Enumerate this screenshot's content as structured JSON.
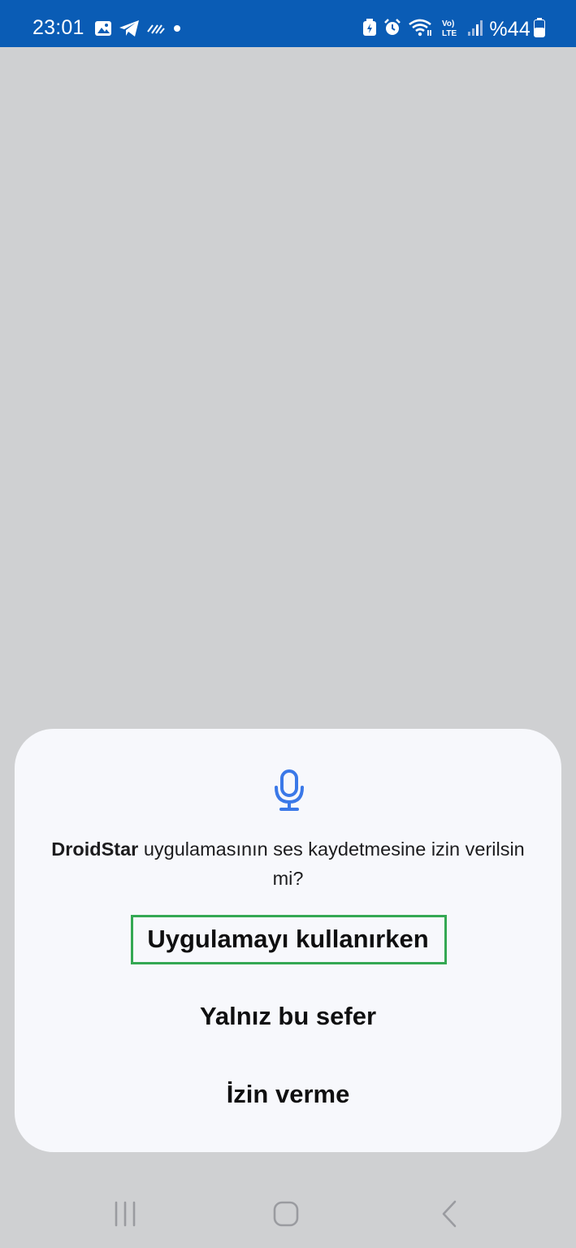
{
  "status_bar": {
    "time": "23:01",
    "battery": "%44",
    "left_icons": [
      "gallery-icon",
      "telegram-icon",
      "data-activity-icon",
      "notification-dot-icon"
    ],
    "right_icons": [
      "battery-saver-icon",
      "alarm-icon",
      "wifi-icon",
      "volte-icon",
      "signal-icon",
      "battery-icon"
    ],
    "background_color": "#0a5cb5"
  },
  "dialog": {
    "icon": "microphone-icon",
    "app_name": "DroidStar",
    "message_rest": " uygulamasının ses kaydetmesine izin verilsin mi?",
    "options": [
      {
        "label": "Uygulamayı kullanırken"
      },
      {
        "label": "Yalnız bu sefer"
      },
      {
        "label": "İzin verme"
      }
    ],
    "accent_color": "#3a78e8",
    "highlight_color": "#34a853"
  },
  "nav_bar": {
    "buttons": [
      "recent-apps",
      "home",
      "back"
    ]
  }
}
